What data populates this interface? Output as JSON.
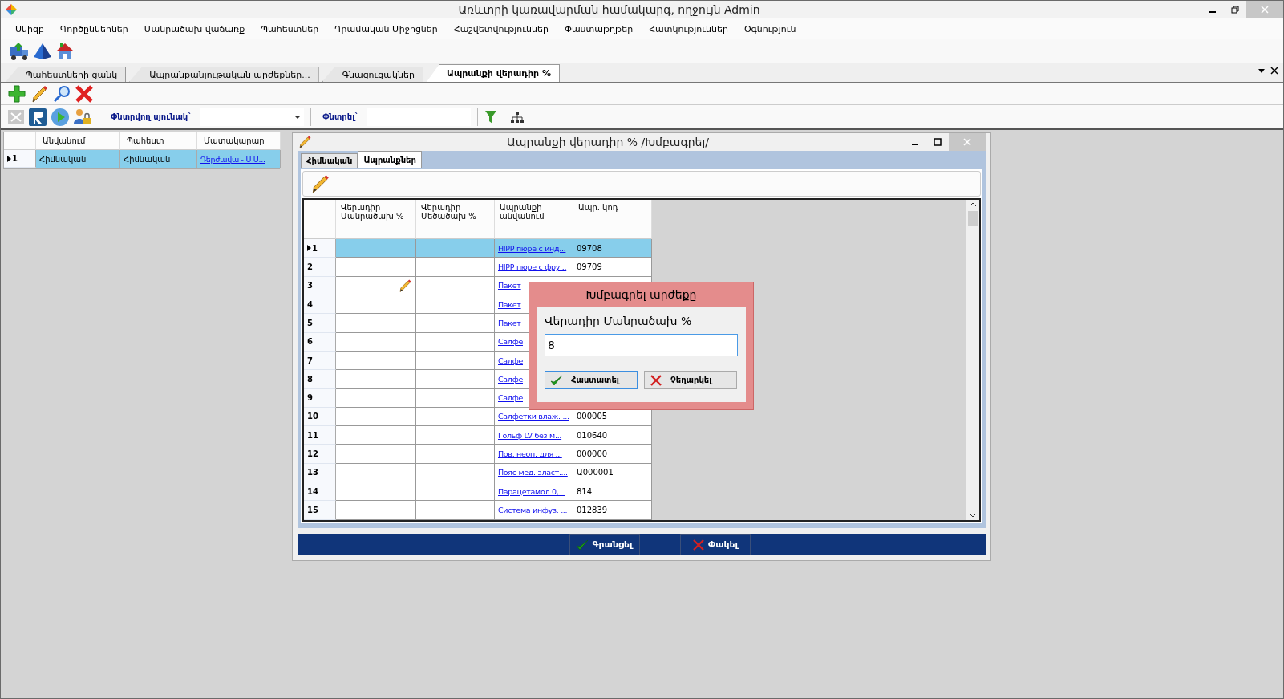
{
  "window": {
    "title": "Առևտրի կառավարման համակարգ, ողջույն Admin"
  },
  "menu": [
    "Սկիզբ",
    "Գործընկերներ",
    "Մանրածախ վաճառք",
    "Պահեստներ",
    "Դրամական Միջոցներ",
    "Հաշվետվություններ",
    "Փաստաթղթեր",
    "Հատկություններ",
    "Օգնություն"
  ],
  "tabs": [
    {
      "label": "Պահեստների ցանկ",
      "selected": false
    },
    {
      "label": "Ապրանքանյութական արժեքներ...",
      "selected": false
    },
    {
      "label": "Գնացուցակներ",
      "selected": false
    },
    {
      "label": "Ապրանքի վերադիր %",
      "selected": true
    }
  ],
  "filter": {
    "column_label": "Փնտրվող սյունակ`",
    "search_label": "Փնտրել`"
  },
  "warehouse_grid": {
    "columns": [
      "Անվանում",
      "Պահեստ",
      "Մատակարար"
    ],
    "rows": [
      {
        "number": "1",
        "selected": true,
        "name": "Հիմնական",
        "warehouse": "Հիմնական",
        "supplier": "Դերժավա - Ս Ս..."
      }
    ]
  },
  "dialog": {
    "title": "Ապրանքի վերադիր % /Խմբագրել/",
    "tabs": [
      {
        "label": "Հիմնական",
        "selected": false
      },
      {
        "label": "Ապրանքներ",
        "selected": true
      }
    ],
    "grid": {
      "columns": [
        "Վերադիր Մանրածախ %",
        "Վերադիր Մեծածախ %",
        "Ապրանքի անվանում",
        "Ապր. կոդ"
      ],
      "rows": [
        {
          "number": "1",
          "selected": true,
          "editing": false,
          "name": "HIPP пюре с инд...",
          "code": "09708"
        },
        {
          "number": "2",
          "selected": false,
          "editing": false,
          "name": "HIPP пюре с фру...",
          "code": "09709"
        },
        {
          "number": "3",
          "selected": false,
          "editing": true,
          "name": "Пакет"
        },
        {
          "number": "4",
          "selected": false,
          "editing": false,
          "name": "Пакет"
        },
        {
          "number": "5",
          "selected": false,
          "editing": false,
          "name": "Пакет"
        },
        {
          "number": "6",
          "selected": false,
          "editing": false,
          "name": "Салфе"
        },
        {
          "number": "7",
          "selected": false,
          "editing": false,
          "name": "Салфе"
        },
        {
          "number": "8",
          "selected": false,
          "editing": false,
          "name": "Салфе"
        },
        {
          "number": "9",
          "selected": false,
          "editing": false,
          "name": "Салфе"
        },
        {
          "number": "10",
          "selected": false,
          "editing": false,
          "name": "Салфетки влаж. ...",
          "code": "000005"
        },
        {
          "number": "11",
          "selected": false,
          "editing": false,
          "name": "Гольф LV без м...",
          "code": "010640"
        },
        {
          "number": "12",
          "selected": false,
          "editing": false,
          "name": "Пов. неоп. для ...",
          "code": "000000"
        },
        {
          "number": "13",
          "selected": false,
          "editing": false,
          "name": "Пояс мед. эласт....",
          "code": "Ա000001"
        },
        {
          "number": "14",
          "selected": false,
          "editing": false,
          "name": "Парацетамол 0,...",
          "code": "814"
        },
        {
          "number": "15",
          "selected": false,
          "editing": false,
          "name": "Система инфуз. ...",
          "code": "012839"
        }
      ]
    },
    "editor": {
      "title": "Խմբագրել արժեքը",
      "label": "Վերադիր Մանրածախ %",
      "value": "8",
      "buttons": [
        {
          "label": "Հաստատել",
          "kind": "confirm"
        },
        {
          "label": "Չեղարկել",
          "kind": "cancel"
        }
      ]
    },
    "buttons": [
      {
        "label": "Գրանցել",
        "kind": "save"
      },
      {
        "label": "Փակել",
        "kind": "close"
      }
    ]
  }
}
